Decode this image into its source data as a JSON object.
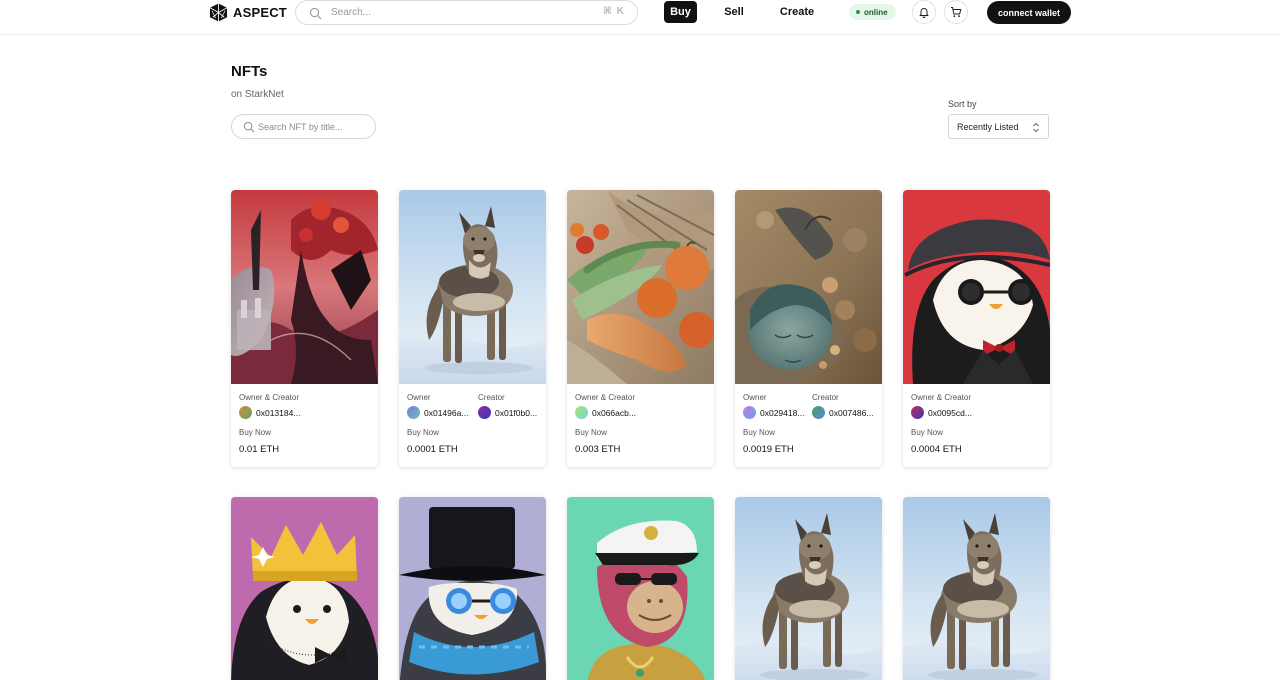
{
  "nav": {
    "brand": "ASPECT",
    "search_placeholder": "Search...",
    "search_shortcut": "⌘ K",
    "links": {
      "buy": "Buy",
      "sell": "Sell",
      "create": "Create"
    },
    "status": "online",
    "connect_wallet": "connect wallet"
  },
  "header": {
    "title": "NFTs",
    "subtitle": "on StarkNet",
    "search_placeholder": "Search NFT by title...",
    "sort_label": "Sort by",
    "sort_value": "Recently Listed"
  },
  "cards": [
    {
      "art": "fantasy-landscape",
      "single_label": "Owner & Creator",
      "owner": "0x013184...",
      "buy_label": "Buy Now",
      "price": "0.01 ETH",
      "avatar_colors": [
        "#d88a3c",
        "#5aa86a"
      ]
    },
    {
      "art": "wolf",
      "owner_label": "Owner",
      "creator_label": "Creator",
      "owner": "0x01496a...",
      "creator": "0x01f0b0...",
      "buy_label": "Buy Now",
      "price": "0.0001 ETH",
      "avatar_colors": [
        "#7b7bd8",
        "#6ac0c0"
      ],
      "creator_colors": [
        "#8a2a9a",
        "#3a3ac0"
      ]
    },
    {
      "art": "vegetables",
      "single_label": "Owner & Creator",
      "owner": "0x066acb...",
      "buy_label": "Buy Now",
      "price": "0.003 ETH",
      "avatar_colors": [
        "#a6e86a",
        "#7ad0e0"
      ]
    },
    {
      "art": "surreal-face",
      "owner_label": "Owner",
      "creator_label": "Creator",
      "owner": "0x029418...",
      "creator": "0x007486...",
      "buy_label": "Buy Now",
      "price": "0.0019 ETH",
      "avatar_colors": [
        "#c07ae0",
        "#6aa0f0"
      ],
      "creator_colors": [
        "#4a9a6a",
        "#5a8ad8"
      ]
    },
    {
      "art": "penguin-beret",
      "single_label": "Owner & Creator",
      "owner": "0x0095cd...",
      "buy_label": "Buy Now",
      "price": "0.0004 ETH",
      "avatar_colors": [
        "#c02a5a",
        "#3a3ab0"
      ]
    },
    {
      "art": "penguin-crown"
    },
    {
      "art": "penguin-tophat"
    },
    {
      "art": "ape-captain"
    },
    {
      "art": "wolf"
    },
    {
      "art": "wolf"
    }
  ]
}
